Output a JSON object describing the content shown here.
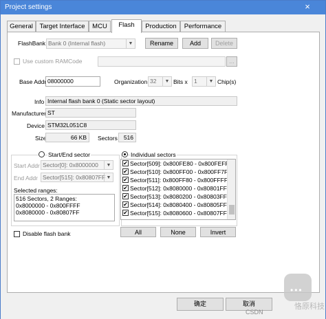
{
  "window": {
    "title": "Project settings",
    "close_glyph": "×"
  },
  "tabs": [
    {
      "label": "General"
    },
    {
      "label": "Target Interface"
    },
    {
      "label": "MCU"
    },
    {
      "label": "Flash",
      "active": true
    },
    {
      "label": "Production"
    },
    {
      "label": "Performance"
    }
  ],
  "flashbank": {
    "label": "FlashBank",
    "value": "Bank 0 (Internal flash)",
    "rename": "Rename",
    "add": "Add",
    "delete": "Delete"
  },
  "ramcode": {
    "label": "Use custom RAMCode",
    "checked": false,
    "value": "",
    "browse": "..."
  },
  "base_addr": {
    "label": "Base Addr",
    "value": "08000000"
  },
  "organization": {
    "label": "Organization",
    "value": "32",
    "bits_label": "Bits x",
    "chips_value": "1",
    "chips_label": "Chip(s)"
  },
  "info": {
    "info_label": "Info",
    "info_value": "Internal flash bank 0 (Static sector layout)",
    "manufacturer_label": "Manufacturer",
    "manufacturer_value": "ST",
    "device_label": "Device",
    "device_value": "STM32L051C8",
    "size_label": "Size",
    "size_value": "66 KB",
    "sectors_label": "Sectors",
    "sectors_value": "516"
  },
  "range": {
    "start_end_label": "Start/End sector",
    "start_addr_label": "Start Addr",
    "start_addr_value": "Sector[0]: 0x8000000",
    "end_addr_label": "End Addr",
    "end_addr_value": "Sector[515]: 0x80807FF",
    "selected_label": "Selected ranges:",
    "selected_lines": [
      "516 Sectors, 2 Ranges:",
      "0x8000000 - 0x800FFFF",
      "0x8080000 - 0x80807FF"
    ]
  },
  "individual": {
    "label": "Individual sectors",
    "selected": true,
    "sectors": [
      "Sector[509]: 0x800FE80 - 0x800FEFF",
      "Sector[510]: 0x800FF00 - 0x800FF7F",
      "Sector[511]: 0x800FF80 - 0x800FFFF",
      "Sector[512]: 0x8080000 - 0x80801FF",
      "Sector[513]: 0x8080200 - 0x80803FF",
      "Sector[514]: 0x8080400 - 0x80805FF",
      "Sector[515]: 0x8080600 - 0x80807FF"
    ],
    "all": "All",
    "none": "None",
    "invert": "Invert"
  },
  "disable_bank": {
    "label": "Disable flash bank",
    "checked": false
  },
  "footer": {
    "ok": "确定",
    "cancel": "取消"
  },
  "watermark": {
    "text": "恪原科技",
    "csdn": "CSDN"
  }
}
